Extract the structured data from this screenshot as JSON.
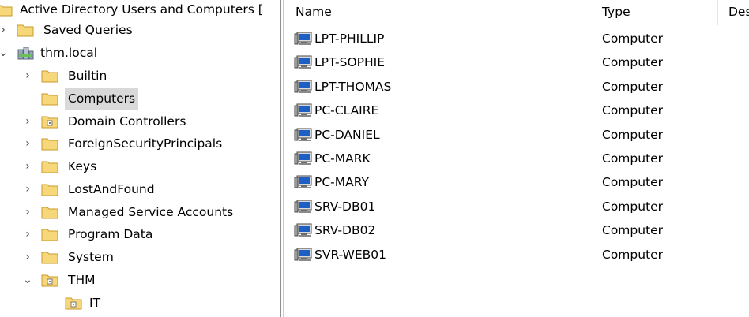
{
  "tree": {
    "root_label": "Active Directory Users and Computers [",
    "items": [
      {
        "label": "Saved Queries",
        "expander": "collapsed",
        "icon": "folder-icon"
      },
      {
        "label": "thm.local",
        "expander": "expanded",
        "icon": "domain-icon"
      },
      {
        "label": "Builtin",
        "expander": "collapsed",
        "icon": "folder-icon"
      },
      {
        "label": "Computers",
        "expander": "none",
        "icon": "folder-icon",
        "selected": true
      },
      {
        "label": "Domain Controllers",
        "expander": "collapsed",
        "icon": "ou-folder-icon"
      },
      {
        "label": "ForeignSecurityPrincipals",
        "expander": "collapsed",
        "icon": "folder-icon"
      },
      {
        "label": "Keys",
        "expander": "collapsed",
        "icon": "folder-icon"
      },
      {
        "label": "LostAndFound",
        "expander": "collapsed",
        "icon": "folder-icon"
      },
      {
        "label": "Managed Service Accounts",
        "expander": "collapsed",
        "icon": "folder-icon"
      },
      {
        "label": "Program Data",
        "expander": "collapsed",
        "icon": "folder-icon"
      },
      {
        "label": "System",
        "expander": "collapsed",
        "icon": "folder-icon"
      },
      {
        "label": "THM",
        "expander": "expanded",
        "icon": "ou-folder-icon"
      },
      {
        "label": "IT",
        "expander": "none",
        "icon": "ou-folder-icon"
      }
    ]
  },
  "list": {
    "columns": [
      "Name",
      "Type",
      "Des"
    ],
    "rows": [
      {
        "name": "LPT-PHILLIP",
        "type": "Computer"
      },
      {
        "name": "LPT-SOPHIE",
        "type": "Computer"
      },
      {
        "name": "LPT-THOMAS",
        "type": "Computer"
      },
      {
        "name": "PC-CLAIRE",
        "type": "Computer"
      },
      {
        "name": "PC-DANIEL",
        "type": "Computer"
      },
      {
        "name": "PC-MARK",
        "type": "Computer"
      },
      {
        "name": "PC-MARY",
        "type": "Computer"
      },
      {
        "name": "SRV-DB01",
        "type": "Computer"
      },
      {
        "name": "SRV-DB02",
        "type": "Computer"
      },
      {
        "name": "SVR-WEB01",
        "type": "Computer"
      }
    ]
  },
  "colors": {
    "folder": "#f6d77a",
    "folder_edge": "#c99a2e",
    "selection": "#d9d9d9",
    "monitor_screen": "#1d5fc4"
  }
}
